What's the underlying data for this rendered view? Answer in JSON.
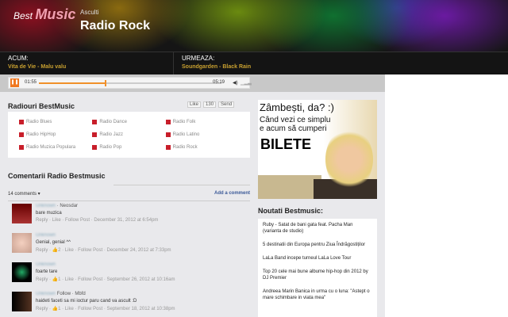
{
  "header": {
    "logo_best": "Best",
    "logo_music": "Music",
    "subtitle": "Asculti",
    "title": "Radio Rock"
  },
  "now": {
    "label": "ACUM:",
    "value": "Vita de Vie - Malu valu"
  },
  "next": {
    "label": "URMEAZA:",
    "value": "Soundgarden - Black Rain"
  },
  "player": {
    "elapsed": "01:55",
    "total": "05:19",
    "progress": 0.36,
    "pause_icon": "pause-icon",
    "volume_icon": "volume-icon"
  },
  "radios": {
    "title": "Radiouri BestMusic",
    "like": "Like",
    "like_count": "130",
    "send": "Send",
    "items": [
      "Radio Blues",
      "Radio Dance",
      "Radio Folk",
      "Radio HipHop",
      "Radio Jazz",
      "Radio Latino",
      "Radio Muzica Populara",
      "Radio Pop",
      "Radio Rock"
    ]
  },
  "comments": {
    "title": "Comentarii Radio Bestmusic",
    "count": "14 comments ▾",
    "add": "Add a comment",
    "items": [
      {
        "name": "Unknown",
        "tag": "· Neosdar",
        "text": "bare muzica",
        "actions": "Reply · Like · Follow Post · December 31, 2012 at 6:54pm"
      },
      {
        "name": "Unknown",
        "tag": "",
        "text": "Genial, genial ^^",
        "actions": "Reply · 👍2 · Like · Follow Post · December 24, 2012 at 7:33pm"
      },
      {
        "name": "Unknown",
        "tag": "",
        "text": "foarte tare",
        "actions": "Reply · 👍1 · Like · Follow Post · September 26, 2012 at 10:16am"
      },
      {
        "name": "Unknown",
        "tag": "Follow · Mbfd",
        "text": "haideti faceti sa mi ioctur paru cand va ascult :D",
        "actions": "Reply · 👍1 · Like · Follow Post · September 18, 2012 at 10:38pm"
      }
    ]
  },
  "ad": {
    "line1": "Zâmbești, da? :)",
    "line2": "Când vezi ce simplu",
    "line3": "e acum să cumperi",
    "line4": "BILETE"
  },
  "news": {
    "title": "Noutati Bestmusic:",
    "items": [
      "Ruby - Satat de bani gata feat. Pacha Man (varianta de studio)",
      "5 destinatii din Europa pentru Ziua Îndrăgostiților",
      "LaLa Band incepe turneul LaLa Love Tour",
      "Top 20 cele mai bune albume hip-hop din 2012 by DJ Premier",
      "Andreea Marin Banica in urma cu o luna: \"Astept o mare schimbare in viata mea\""
    ]
  }
}
